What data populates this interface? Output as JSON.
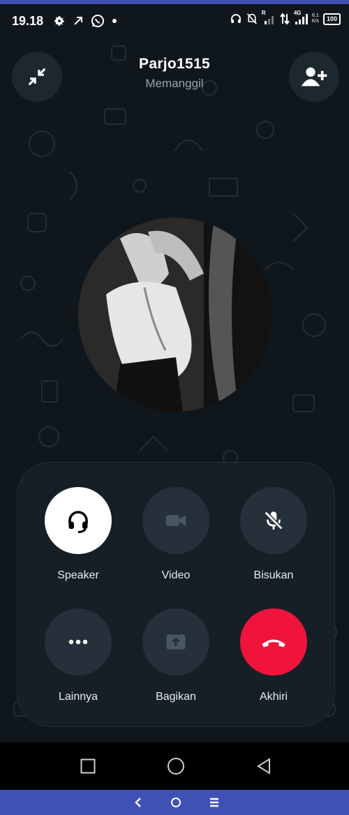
{
  "status_bar": {
    "time": "19.18",
    "left_icons": [
      "gear-icon",
      "arrow-up-right-icon",
      "whatsapp-icon",
      "dot-icon"
    ],
    "right_icons": [
      "headset-icon",
      "mute-bell-icon",
      "signal-r-icon",
      "data-arrows-icon",
      "signal-4g-icon"
    ],
    "signal_r_label": "R",
    "network_label": "4G",
    "net_speed_value": "6.1",
    "net_speed_unit": "K/s",
    "battery": "100"
  },
  "call": {
    "contact_name": "Parjo1515",
    "call_state": "Memanggil"
  },
  "controls": [
    {
      "key": "speaker",
      "label": "Speaker",
      "icon": "headset-icon",
      "active": true
    },
    {
      "key": "video",
      "label": "Video",
      "icon": "video-camera-icon",
      "active": false
    },
    {
      "key": "mute",
      "label": "Bisukan",
      "icon": "mic-off-icon",
      "active": false
    },
    {
      "key": "more",
      "label": "Lainnya",
      "icon": "more-dots-icon",
      "active": false
    },
    {
      "key": "share",
      "label": "Bagikan",
      "icon": "share-screen-icon",
      "active": false
    },
    {
      "key": "end",
      "label": "Akhiri",
      "icon": "end-call-icon",
      "active": false
    }
  ],
  "colors": {
    "background": "#0b141a",
    "panel": "#161f26",
    "button": "#25303a",
    "end_call": "#f0143c",
    "accent_bar": "#3f51b5"
  }
}
